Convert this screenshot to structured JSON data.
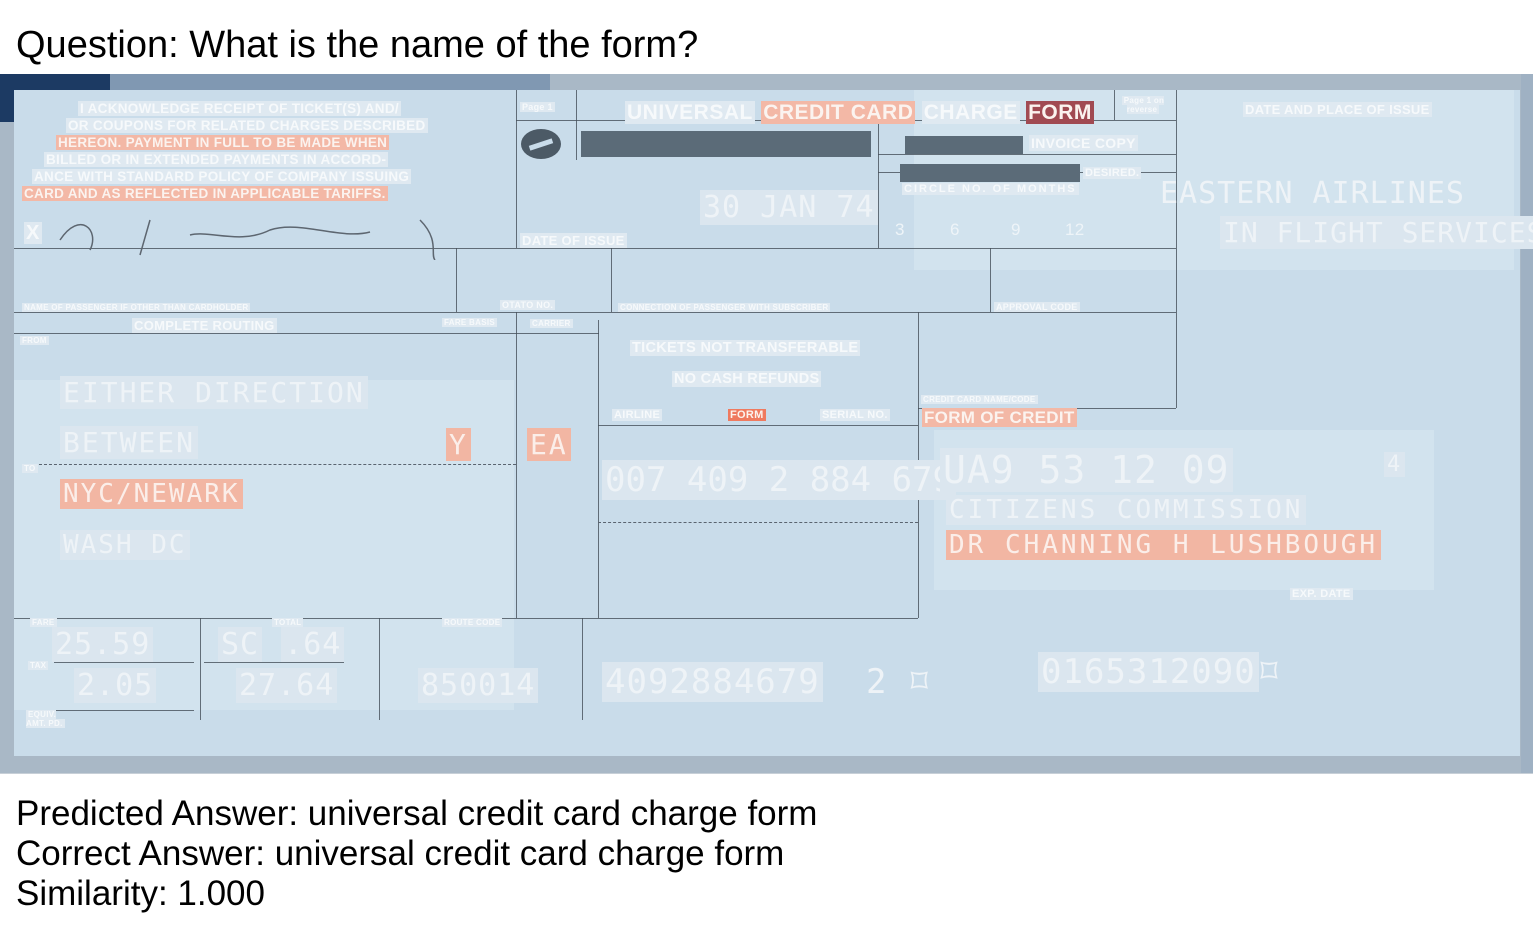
{
  "question": "Question: What is the name of the form?",
  "predicted": "Predicted Answer: universal credit card charge form",
  "correct": "Correct Answer: universal credit card charge form",
  "similarity": "Similarity: 1.000",
  "ticket": {
    "ack_lines": [
      "I ACKNOWLEDGE RECEIPT OF TICKET(S) AND/",
      "OR COUPONS FOR RELATED CHARGES DESCRIBED",
      "HEREON. PAYMENT IN FULL TO BE MADE WHEN",
      "BILLED OR IN EXTENDED PAYMENTS IN ACCORD-",
      "ANCE WITH STANDARD POLICY OF COMPANY ISSUING",
      "CARD AND AS REFLECTED IN APPLICABLE TARIFFS."
    ],
    "page_ref": "Page 1",
    "title_universal": "UNIVERSAL",
    "title_credit_card": "CREDIT CARD",
    "title_charge": "CHARGE",
    "title_form": "FORM",
    "page_on_reverse": "Page 1 on reverse",
    "date_place_issue": "DATE AND PLACE OF ISSUE",
    "invoice_copy": "INVOICE COPY",
    "desired": "DESIRED.",
    "circle_months": "CIRCLE NO. OF MONTHS",
    "months": [
      "3",
      "6",
      "9",
      "12"
    ],
    "issuer_name": "EASTERN AIRLINES",
    "issuer_sub": "IN FLIGHT SERVICES",
    "issue_date": "30 JAN 74",
    "date_of_issue": "DATE OF ISSUE",
    "x_mark": "X",
    "name_passenger": "NAME OF PASSENGER IF OTHER THAN CARDHOLDER",
    "complete_routing": "COMPLETE ROUTING",
    "otato_no": "OTATO NO.",
    "fare_basis": "FARE BASIS",
    "carrier": "CARRIER",
    "connection": "CONNECTION OF PASSENGER WITH SUBSCRIBER",
    "approval_code": "APPROVAL CODE",
    "from": "FROM",
    "to": "TO",
    "routing_1": "EITHER DIRECTION",
    "routing_2": "BETWEEN",
    "routing_3": "NYC/NEWARK",
    "routing_4": "WASH DC",
    "fare_code": "Y",
    "carrier_code": "EA",
    "tickets_not_transferable": "TICKETS NOT TRANSFERABLE",
    "no_cash_refunds": "NO CASH REFUNDS",
    "airline": "AIRLINE",
    "form": "FORM",
    "serial_no": "SERIAL NO.",
    "ticket_number": "007 409 2 884 679",
    "credit_card_name_code": "CREDIT CARD NAME/CODE",
    "form_of_credit": "FORM OF CREDIT",
    "card_number": "UA9 53 12 09",
    "card_suffix": "4",
    "card_holder_1": "CITIZENS COMMISSION",
    "card_holder_2": "DR CHANNING H LUSHBOUGH",
    "exp_date": "EXP. DATE",
    "fare_label": "FARE",
    "tax_label": "TAX",
    "total_label": "TOTAL",
    "equiv_label": "EQUIV. AMT. PD.",
    "route_code": "ROUTE CODE",
    "fare_value": "25.59",
    "tax_value": "2.05",
    "total_prefix": "SC",
    "total_cents": ".64",
    "total_value": "27.64",
    "route_code_value": "850014",
    "bottom_number_1": "4092884679",
    "bottom_number_2": "2",
    "bottom_number_3": "0165312090"
  }
}
